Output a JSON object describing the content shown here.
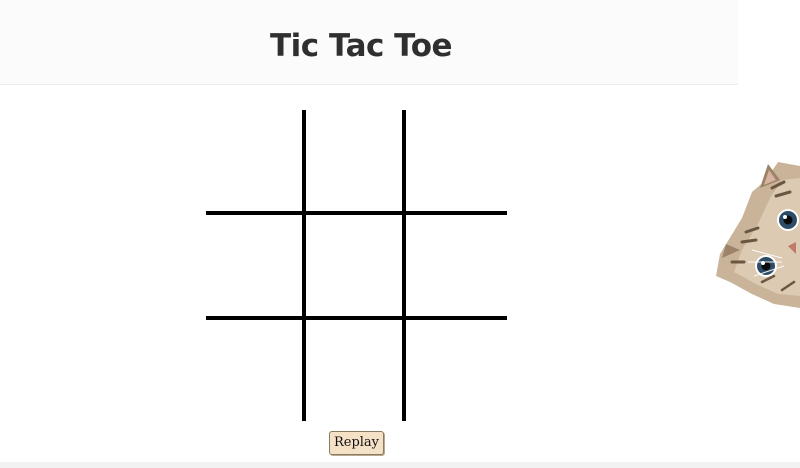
{
  "header": {
    "title": "Tic Tac Toe"
  },
  "board": {
    "rows": 3,
    "cols": 3,
    "cells": [
      "",
      "",
      "",
      "",
      "",
      "",
      "",
      "",
      ""
    ]
  },
  "controls": {
    "replay_label": "Replay"
  },
  "decor": {
    "image": "peeking-cat-icon"
  },
  "colors": {
    "grid": "#000000",
    "button_bg": "#f5e1c5",
    "title": "#2f2f2f"
  }
}
